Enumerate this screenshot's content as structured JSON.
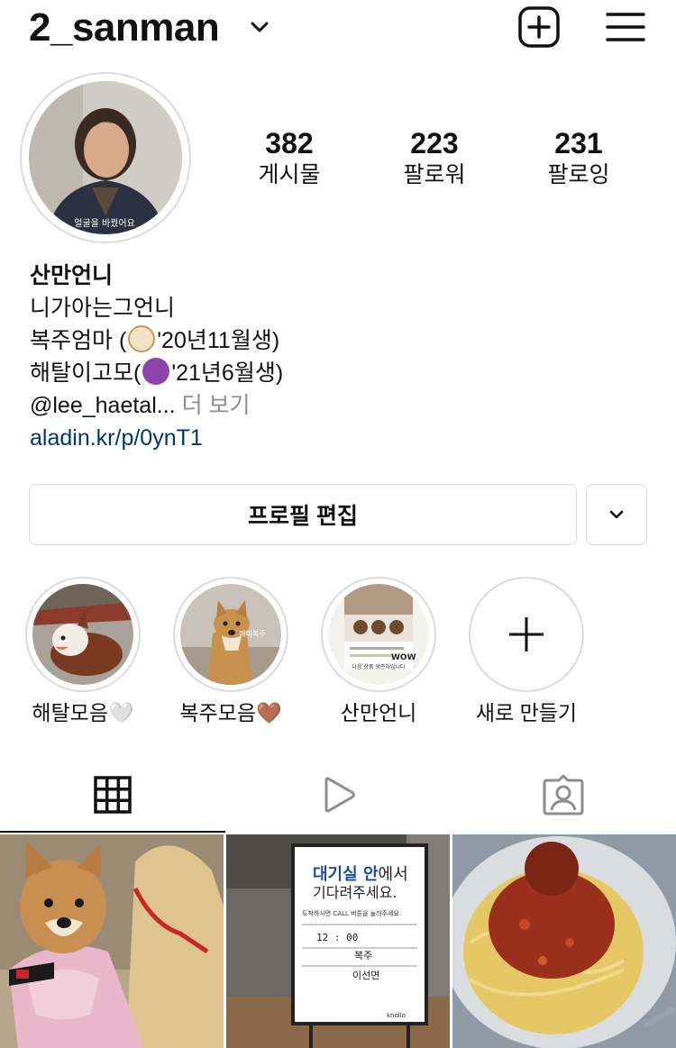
{
  "header": {
    "username": "2_sanman",
    "icons": {
      "dropdown": "chevron-down-icon",
      "add": "plus-square-icon",
      "menu": "hamburger-menu-icon"
    }
  },
  "profile": {
    "avatar_caption": "얼굴을 바꿨어요",
    "stats": [
      {
        "value": "382",
        "label": "게시물"
      },
      {
        "value": "223",
        "label": "팔로워"
      },
      {
        "value": "231",
        "label": "팔로잉"
      }
    ],
    "display_name": "산만언니",
    "bio_lines": {
      "line1": "니가아는그언니",
      "line2_pre": "복주엄마 (",
      "line2_post": "'20년11월생)",
      "line3_pre": "해탈이고모(",
      "line3_post": "'21년6월생)",
      "line4": "@lee_haetal...",
      "more": "더 보기"
    },
    "link": "aladin.kr/p/0ynT1",
    "link_color": "#00376b"
  },
  "actions": {
    "edit_profile": "프로필 편집"
  },
  "highlights": [
    {
      "label": "해탈모음🤍"
    },
    {
      "label": "복주모음🤎",
      "caption": "애미복주"
    },
    {
      "label": "산만언니",
      "poster_text": "WOW",
      "poster_caption": "다음 상품 생존자입니다"
    },
    {
      "label": "새로 만들기"
    }
  ],
  "tabs": [
    {
      "name": "grid",
      "icon": "grid-icon",
      "active": true
    },
    {
      "name": "reels",
      "icon": "play-icon",
      "active": false
    },
    {
      "name": "tagged",
      "icon": "tagged-user-icon",
      "active": false
    }
  ],
  "posts": [
    {
      "subject": "dog-in-sweater"
    },
    {
      "subject": "waiting-room-sign",
      "sign": {
        "title_bold": "대기실 안",
        "title_rest": "에서",
        "title_line2": "기다려주세요.",
        "call_hint": "도착하시면 CALL 버튼을 눌러주세요.",
        "time": "12 : 00",
        "label_name": "복주",
        "label_person": "이선면",
        "brand": "knollo"
      }
    },
    {
      "subject": "spaghetti-meatballs"
    }
  ]
}
